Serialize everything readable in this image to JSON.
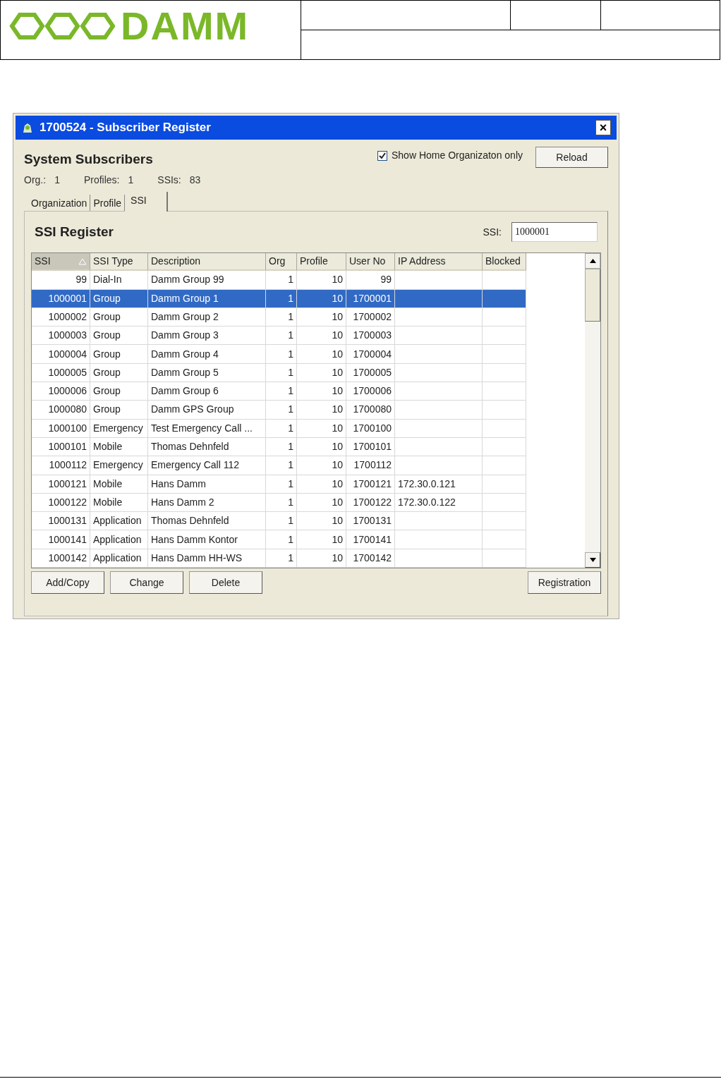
{
  "header": {
    "logo": "DAMM"
  },
  "window": {
    "title": "1700524 - Subscriber Register",
    "close": "×"
  },
  "heading": "System Subscribers",
  "show_home_only": {
    "label": "Show Home Organizaton only",
    "checked": true
  },
  "reload_button": "Reload",
  "stats": [
    {
      "label": "Org.:",
      "value": "1"
    },
    {
      "label": "Profiles:",
      "value": "1"
    },
    {
      "label": "SSIs:",
      "value": "83"
    }
  ],
  "tabs": [
    {
      "label": "Organization",
      "selected": false
    },
    {
      "label": "Profile",
      "selected": false
    },
    {
      "label": "SSI",
      "selected": true
    }
  ],
  "panel_title": "SSI Register",
  "ssi_field": {
    "label": "SSI:",
    "value": "1000001"
  },
  "table": {
    "columns": [
      {
        "label": "SSI",
        "sorted": true
      },
      {
        "label": "SSI Type",
        "sorted": false
      },
      {
        "label": "Description",
        "sorted": false
      },
      {
        "label": "Org",
        "sorted": false
      },
      {
        "label": "Profile",
        "sorted": false
      },
      {
        "label": "User No",
        "sorted": false
      },
      {
        "label": "IP Address",
        "sorted": false
      },
      {
        "label": "Blocked",
        "sorted": false
      }
    ],
    "rows": [
      {
        "cells": [
          "99",
          "Dial-In",
          "Damm Group 99",
          "1",
          "10",
          "99",
          "",
          ""
        ],
        "selected": false
      },
      {
        "cells": [
          "1000001",
          "Group",
          "Damm Group 1",
          "1",
          "10",
          "1700001",
          "",
          ""
        ],
        "selected": true
      },
      {
        "cells": [
          "1000002",
          "Group",
          "Damm Group 2",
          "1",
          "10",
          "1700002",
          "",
          ""
        ],
        "selected": false
      },
      {
        "cells": [
          "1000003",
          "Group",
          "Damm Group 3",
          "1",
          "10",
          "1700003",
          "",
          ""
        ],
        "selected": false
      },
      {
        "cells": [
          "1000004",
          "Group",
          "Damm Group 4",
          "1",
          "10",
          "1700004",
          "",
          ""
        ],
        "selected": false
      },
      {
        "cells": [
          "1000005",
          "Group",
          "Damm Group 5",
          "1",
          "10",
          "1700005",
          "",
          ""
        ],
        "selected": false
      },
      {
        "cells": [
          "1000006",
          "Group",
          "Damm Group 6",
          "1",
          "10",
          "1700006",
          "",
          ""
        ],
        "selected": false
      },
      {
        "cells": [
          "1000080",
          "Group",
          "Damm GPS Group",
          "1",
          "10",
          "1700080",
          "",
          ""
        ],
        "selected": false
      },
      {
        "cells": [
          "1000100",
          "Emergency",
          "Test Emergency Call ...",
          "1",
          "10",
          "1700100",
          "",
          ""
        ],
        "selected": false
      },
      {
        "cells": [
          "1000101",
          "Mobile",
          "Thomas Dehnfeld",
          "1",
          "10",
          "1700101",
          "",
          ""
        ],
        "selected": false
      },
      {
        "cells": [
          "1000112",
          "Emergency",
          "Emergency Call 112",
          "1",
          "10",
          "1700112",
          "",
          ""
        ],
        "selected": false
      },
      {
        "cells": [
          "1000121",
          "Mobile",
          "Hans Damm",
          "1",
          "10",
          "1700121",
          "172.30.0.121",
          ""
        ],
        "selected": false
      },
      {
        "cells": [
          "1000122",
          "Mobile",
          "Hans Damm 2",
          "1",
          "10",
          "1700122",
          "172.30.0.122",
          ""
        ],
        "selected": false
      },
      {
        "cells": [
          "1000131",
          "Application",
          "Thomas Dehnfeld",
          "1",
          "10",
          "1700131",
          "",
          ""
        ],
        "selected": false
      },
      {
        "cells": [
          "1000141",
          "Application",
          "Hans Damm Kontor",
          "1",
          "10",
          "1700141",
          "",
          ""
        ],
        "selected": false
      },
      {
        "cells": [
          "1000142",
          "Application",
          "Hans Damm HH-WS",
          "1",
          "10",
          "1700142",
          "",
          ""
        ],
        "selected": false
      }
    ]
  },
  "buttons": [
    "Add/Copy",
    "Change",
    "Delete"
  ],
  "registration_button": "Registration"
}
